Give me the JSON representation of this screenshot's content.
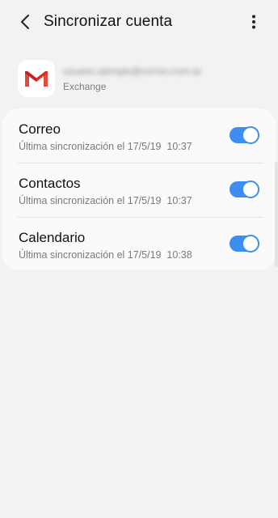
{
  "header": {
    "title": "Sincronizar cuenta",
    "back_icon": "back-arrow-icon",
    "more_icon": "more-vert-icon"
  },
  "account": {
    "email": "usuario.ejemplo@correo.com.ar",
    "type": "Exchange",
    "logo_icon": "gmail-icon"
  },
  "colors": {
    "accent": "#3e8df0",
    "background": "#f2f2f2",
    "card": "#fafafa"
  },
  "sync_items": [
    {
      "label": "Correo",
      "last_sync": "Última sincronización el 17/5/19  10:37",
      "enabled": true
    },
    {
      "label": "Contactos",
      "last_sync": "Última sincronización el 17/5/19  10:37",
      "enabled": true
    },
    {
      "label": "Calendario",
      "last_sync": "Última sincronización el 17/5/19  10:38",
      "enabled": true
    }
  ]
}
